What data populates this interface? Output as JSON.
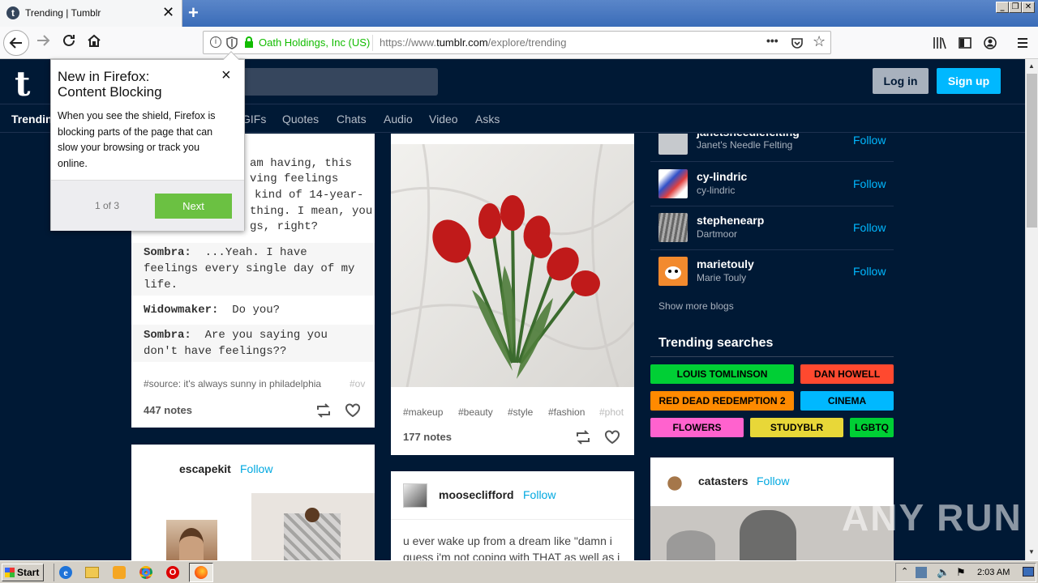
{
  "browser": {
    "tab_title": "Trending | Tumblr",
    "tab_favicon": "t",
    "close_tab": "✕",
    "new_tab": "+",
    "identity_org": "Oath Holdings, Inc (US)",
    "url_prefix": "https://www.",
    "url_domain": "tumblr.com",
    "url_path": "/explore/trending",
    "page_actions": "•••"
  },
  "header": {
    "logo": "t",
    "login_label": "Log in",
    "signup_label": "Sign up"
  },
  "subnav": {
    "items": [
      "Trending",
      "GIFs",
      "Quotes",
      "Chats",
      "Audio",
      "Video",
      "Asks"
    ]
  },
  "popup": {
    "title_line1": "New in Firefox:",
    "title_line2": "Content Blocking",
    "body": "When you see the shield, Firefox is blocking parts of the page that can slow your browsing or track you online.",
    "step": "1 of 3",
    "next_label": "Next",
    "close": "×"
  },
  "chat_post": {
    "frag1": "am having, this",
    "frag2": "ving feelings",
    "frag3": "kind of 14-year-",
    "frag4": "thing. I mean, you",
    "frag5": "gs, right?",
    "lines": [
      {
        "speaker": "Sombra:",
        "text": "...Yeah. I have",
        "cont": "feelings every single day of my",
        "cont2": "life."
      },
      {
        "speaker": "Widowmaker:",
        "text": "Do you?"
      },
      {
        "speaker": "Sombra:",
        "text": "Are you saying you",
        "cont": "don't have feelings??"
      }
    ],
    "tags": [
      "#source: it's always sunny in philadelphia",
      "#ov"
    ],
    "notes": "447 notes"
  },
  "photo_post": {
    "tags": [
      "#makeup",
      "#beauty",
      "#style",
      "#fashion",
      "#phot"
    ],
    "notes": "177 notes"
  },
  "escape_post": {
    "blog": "escapekit",
    "follow": "Follow"
  },
  "moose_post": {
    "blog": "mooseclifford",
    "follow": "Follow",
    "text1": "u ever wake up from a dream like \"damn i",
    "text2": "guess i'm not coping with THAT as well as i"
  },
  "cat_post": {
    "blog": "catasters",
    "follow": "Follow"
  },
  "recommended_blogs": [
    {
      "name": "janetsneedlefelting",
      "title": "Janet's Needle Felting",
      "follow": "Follow"
    },
    {
      "name": "cy-lindric",
      "title": "cy-lindric",
      "follow": "Follow"
    },
    {
      "name": "stephenearp",
      "title": "Dartmoor",
      "follow": "Follow"
    },
    {
      "name": "marietouly",
      "title": "Marie Touly",
      "follow": "Follow"
    }
  ],
  "show_more": "Show more blogs",
  "trending": {
    "heading": "Trending searches",
    "pills": [
      {
        "label": "LOUIS TOMLINSON",
        "color": "#00cf35"
      },
      {
        "label": "DAN HOWELL",
        "color": "#ff492f"
      },
      {
        "label": "RED DEAD REDEMPTION 2",
        "color": "#ff8a00"
      },
      {
        "label": "CINEMA",
        "color": "#00b8ff"
      },
      {
        "label": "FLOWERS",
        "color": "#ff62ce"
      },
      {
        "label": "STUDYBLR",
        "color": "#e8d738"
      },
      {
        "label": "LGBTQ",
        "color": "#00cf35"
      }
    ]
  },
  "watermark": "ANY RUN",
  "taskbar": {
    "start": "Start",
    "clock": "2:03 AM"
  }
}
